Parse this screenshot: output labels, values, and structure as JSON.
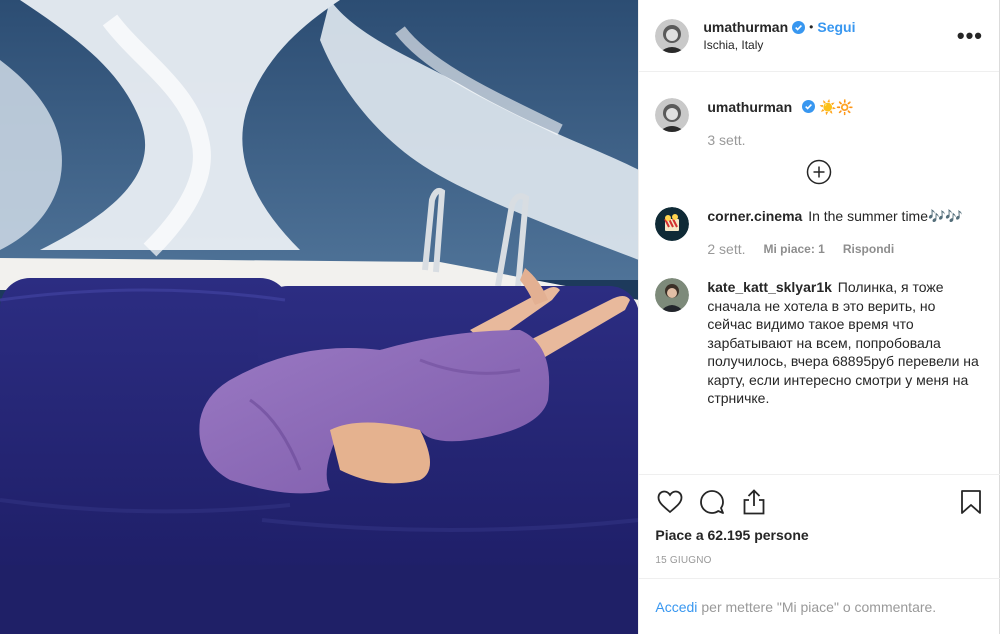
{
  "post": {
    "author": {
      "username": "umathurman",
      "follow_label": "Segui",
      "location": "Ischia, Italy",
      "more_label": "•••"
    },
    "caption": {
      "username": "umathurman",
      "emoji": "☀️🔆",
      "time": "3 sett."
    },
    "comments": [
      {
        "username": "corner.cinema",
        "text": "In the summer time🎶🎶",
        "time": "2 sett.",
        "likes": "Mi piace: 1",
        "reply": "Rispondi"
      },
      {
        "username": "kate_katt_sklyar1k",
        "text": "Полинка, я тоже сначала не хотела в это верить, но сейчас видимо такое время что зарбатывают на всем, попробовала получилось, вчера 68895руб перевели на карту, если интересно смотри у меня на стрничке."
      }
    ],
    "likes_text": "Piace a 62.195 persone",
    "date": "15 giugno",
    "login": {
      "link": "Accedi",
      "rest": "per mettere \"Mi piace\" o commentare."
    }
  },
  "colors": {
    "accent": "#3897f0",
    "verified": "#3897f0",
    "text": "#262626",
    "muted": "#999999"
  },
  "icons": [
    "verified-badge-icon",
    "more-options-icon",
    "load-more-icon",
    "heart-icon",
    "comment-icon",
    "share-icon",
    "bookmark-icon"
  ]
}
